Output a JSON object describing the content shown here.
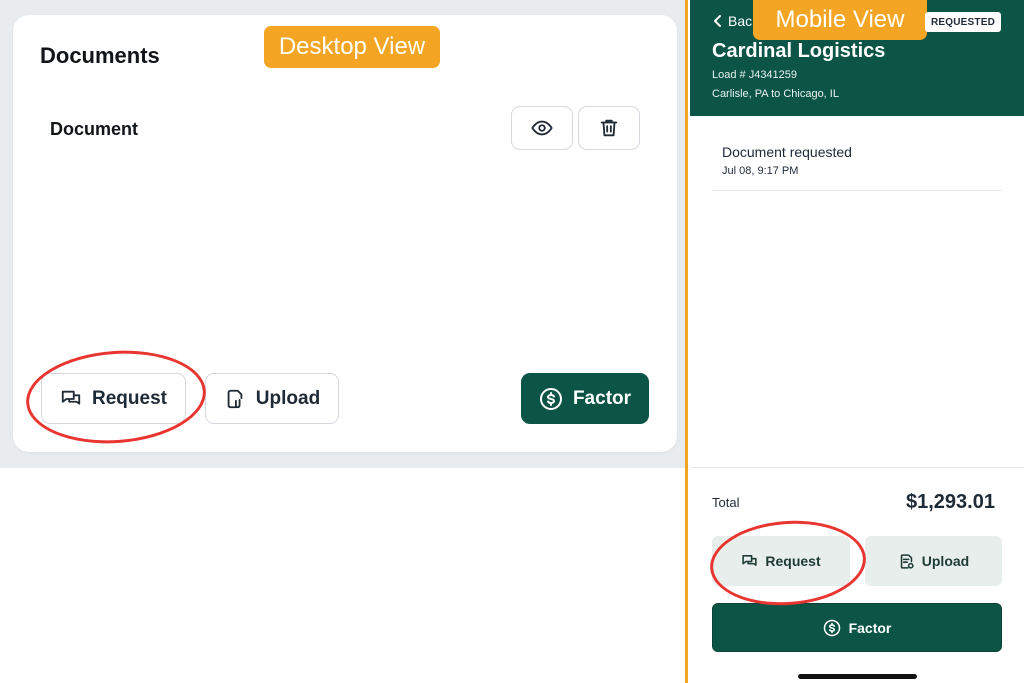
{
  "labels": {
    "desktop_view": "Desktop View",
    "mobile_view": "Mobile View"
  },
  "desktop": {
    "title": "Documents",
    "document_label": "Document",
    "buttons": {
      "request": "Request",
      "upload": "Upload",
      "factor": "Factor"
    }
  },
  "mobile": {
    "back_label": "Back",
    "status_badge": "REQUESTED",
    "company": "Cardinal Logistics",
    "load": "Load # J4341259",
    "route": "Carlisle, PA to Chicago, IL",
    "event": {
      "title": "Document requested",
      "time": "Jul 08, 9:17 PM"
    },
    "total_label": "Total",
    "total_value": "$1,293.01",
    "buttons": {
      "request": "Request",
      "upload": "Upload",
      "factor": "Factor"
    }
  },
  "colors": {
    "brand_green": "#0c5546",
    "label_orange": "#f5a524",
    "annotation_red": "#e8352f"
  },
  "icons": [
    "chat-icon",
    "paperclip-file-icon",
    "dollar-circle-icon",
    "eye-icon",
    "trash-icon",
    "chevron-left-icon",
    "document-upload-icon"
  ]
}
